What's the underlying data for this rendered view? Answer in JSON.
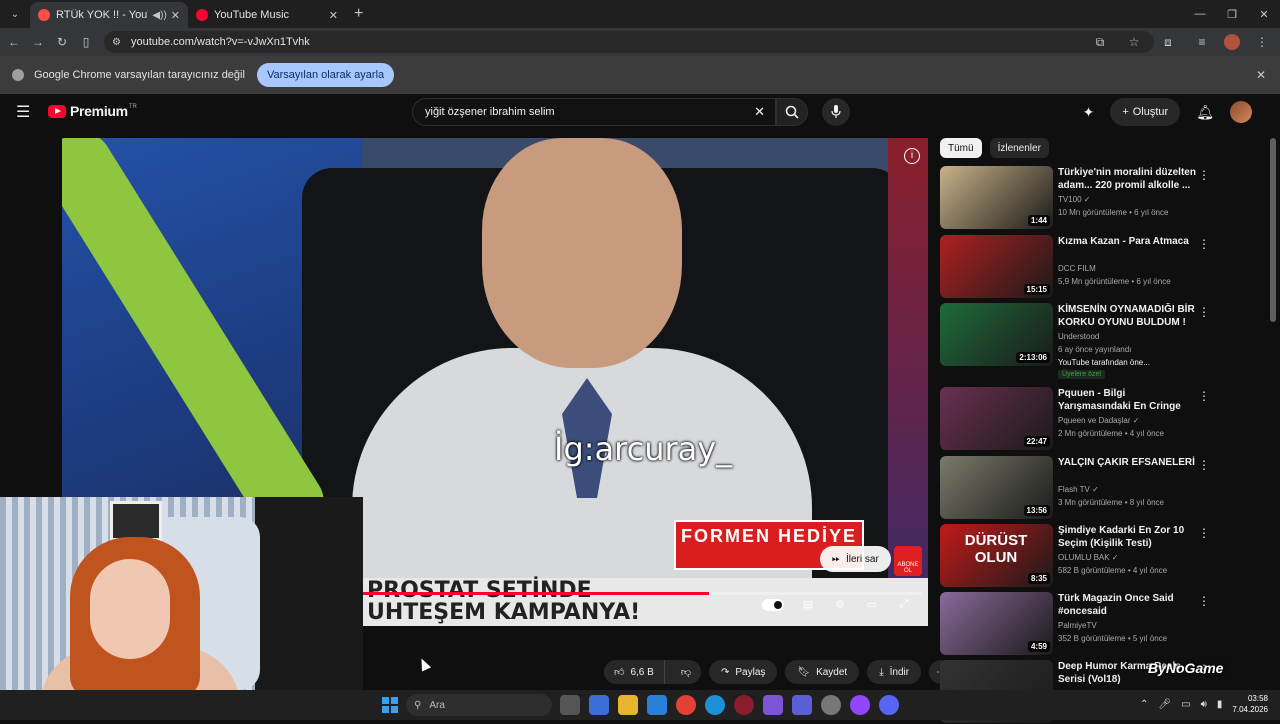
{
  "browser": {
    "tabs": [
      {
        "label": "RTÜk YOK !! - YouTube",
        "active": true
      },
      {
        "label": "YouTube Music",
        "active": false
      }
    ],
    "url": "youtube.com/watch?v=-vJwXn1Tvhk",
    "infobar": {
      "message": "Google Chrome varsayılan tarayıcınız değil",
      "button": "Varsayılan olarak ayarla"
    }
  },
  "youtube": {
    "logo": "Premium",
    "logo_sup": "TR",
    "search_value": "yiğit özşener ibrahim selim",
    "create_label": "Oluştur"
  },
  "player": {
    "caption": "İg:arcuray_",
    "tv_box": "FORMEN HEDİYE",
    "banner_line1": "PROSTAT SETİNDE",
    "banner_line2": "UHTEŞEM KAMPANYA!",
    "skip_label": "İleri sar",
    "abone": "ABONE OL",
    "progress": 0.62
  },
  "actions": {
    "likes": "6,6 B",
    "share": "Paylaş",
    "save": "Kaydet",
    "download": "İndir"
  },
  "sidebar": {
    "chips": [
      "Tümü",
      "İzlenenler"
    ],
    "videos": [
      {
        "title": "Türkiye'nin moralini düzelten adam... 220 promil alkolle ...",
        "channel": "TV100 ✓",
        "meta": "10 Mn görüntüleme • 6 yıl önce",
        "duration": "1:44",
        "color": "#c9b28a"
      },
      {
        "title": "Kızma Kazan - Para Atmaca",
        "channel": "DCC FILM",
        "meta": "5,9 Mn görüntüleme • 6 yıl önce",
        "duration": "15:15",
        "color": "#b02020"
      },
      {
        "title": "KİMSENİN OYNAMADIĞI BİR KORKU OYUNU BULDUM !",
        "channel": "Understood",
        "meta": "6 ay önce yayınlandı",
        "extra": "YouTube tarafından öne...",
        "badge": "Üyelere özel",
        "duration": "2:13:06",
        "color": "#1f6b3a"
      },
      {
        "title": "Pquuen - Bilgi Yarışmasındaki En Cringe Yarışmacıları İzliyor ...",
        "channel": "Pqueen ve Dadaşlar ✓",
        "meta": "2 Mn görüntüleme • 4 yıl önce",
        "duration": "22:47",
        "color": "#6a3050"
      },
      {
        "title": "YALÇIN ÇAKIR EFSANELERİ",
        "channel": "Flash TV ✓",
        "meta": "3 Mn görüntüleme • 8 yıl önce",
        "duration": "13:56",
        "color": "#7a7a6a"
      },
      {
        "title": "Şimdiye Kadarki En Zor 10 Seçim (Kişilik Testi)",
        "channel": "OLUMLU BAK ✓",
        "meta": "582 B görüntüleme • 4 yıl önce",
        "duration": "8:35",
        "color": "#c21a1a",
        "thumb_text": "DÜRÜST OLUN"
      },
      {
        "title": "Türk Magazin Once Said #oncesaid",
        "channel": "PalmiyeTV",
        "meta": "352 B görüntüleme • 5 yıl önce",
        "duration": "4:59",
        "color": "#8a6a9a"
      },
      {
        "title": "Deep Humor Karma Reels Serisi (Vol18)",
        "channel": "",
        "meta": "",
        "duration": "",
        "color": "#333333"
      }
    ]
  },
  "watermark": "ByNoGame",
  "taskbar": {
    "search_placeholder": "Ara",
    "time": "03:58",
    "date": "7.04.2026"
  }
}
